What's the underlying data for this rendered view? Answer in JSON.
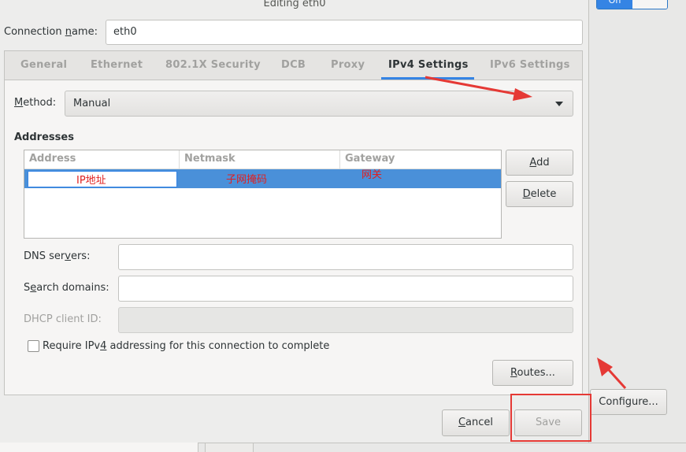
{
  "dialog": {
    "title": "Editing eth0",
    "connection_name_label_pre": "Connection ",
    "connection_name_label_mn": "n",
    "connection_name_label_post": "ame:",
    "connection_name_value": "eth0"
  },
  "tabs": [
    {
      "label": "General"
    },
    {
      "label": "Ethernet"
    },
    {
      "label": "802.1X Security"
    },
    {
      "label": "DCB"
    },
    {
      "label": "Proxy"
    },
    {
      "label": "IPv4 Settings",
      "active": true
    },
    {
      "label": "IPv6 Settings"
    }
  ],
  "ipv4": {
    "method_label_mn": "M",
    "method_label_rest": "ethod:",
    "method_value": "Manual",
    "addresses_label": "Addresses",
    "columns": [
      "Address",
      "Netmask",
      "Gateway"
    ],
    "annotation_address": "IP地址",
    "annotation_netmask": "子网掩码",
    "annotation_gateway": "网关",
    "add_mn": "A",
    "add_rest": "dd",
    "delete_mn": "D",
    "delete_rest": "elete",
    "dns_label_pre": "DNS ser",
    "dns_label_mn": "v",
    "dns_label_post": "ers:",
    "dns_value": "",
    "search_label_pre": "S",
    "search_label_mn": "e",
    "search_label_post": "arch domains:",
    "search_value": "",
    "dhcp_label": "DHCP client ID:",
    "dhcp_value": "",
    "require_pre": "Require IPv",
    "require_mn": "4",
    "require_post": " addressing for this connection to complete",
    "require_checked": false,
    "routes_mn": "R",
    "routes_rest": "outes..."
  },
  "footer": {
    "cancel_mn": "C",
    "cancel_rest": "ancel",
    "save_label": "Save"
  },
  "side": {
    "configure_label": "Configure...",
    "toggle_on_label": "On"
  },
  "colors": {
    "accent": "#3584e4",
    "annotation_red": "#e53935",
    "selected_row": "#4a90d9"
  }
}
